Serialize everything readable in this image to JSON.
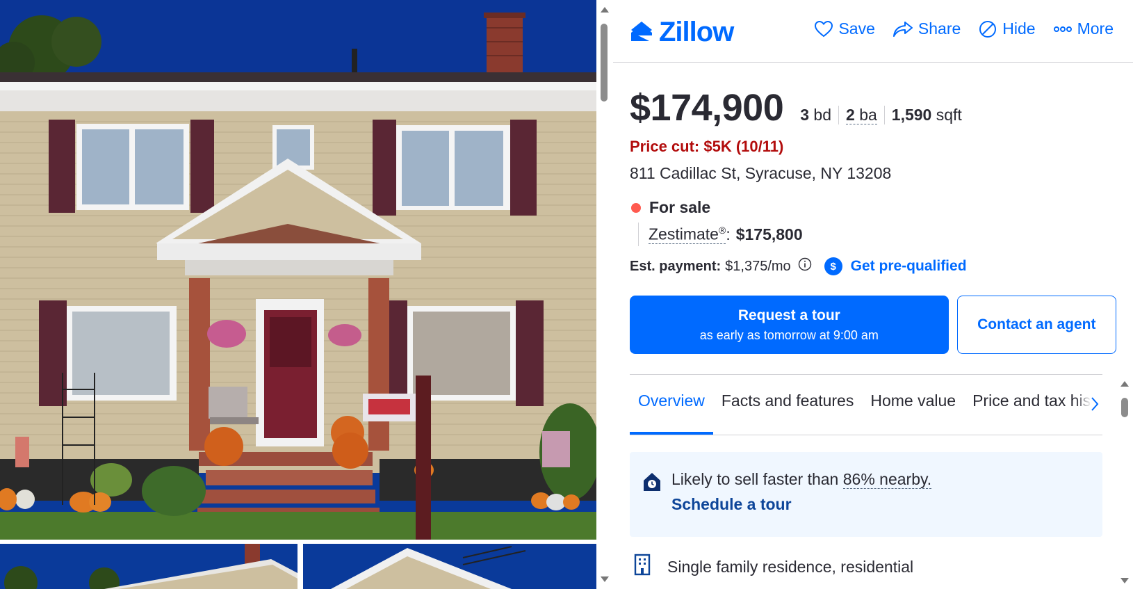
{
  "brand": {
    "name": "Zillow",
    "color": "#006aff",
    "icon": "zillow-logo-icon"
  },
  "header_actions": [
    {
      "label": "Save",
      "icon": "heart-icon"
    },
    {
      "label": "Share",
      "icon": "share-arrow-icon"
    },
    {
      "label": "Hide",
      "icon": "hide-circle-slash-icon"
    },
    {
      "label": "More",
      "icon": "more-dots-icon"
    }
  ],
  "listing": {
    "price": "$174,900",
    "beds_value": "3",
    "beds_unit": "bd",
    "baths_value": "2",
    "baths_unit": "ba",
    "sqft_value": "1,590",
    "sqft_unit": "sqft",
    "price_cut": "Price cut: $5K (10/11)",
    "address": "811 Cadillac St, Syracuse, NY 13208",
    "status": "For sale",
    "status_color": "#ff5a4f",
    "zestimate_label": "Zestimate",
    "zestimate_mark": "®",
    "zestimate_value": "$175,800",
    "payment_label": "Est. payment:",
    "payment_value": "$1,375/mo",
    "prequal_label": "Get pre-qualified",
    "prequal_icon_text": "$"
  },
  "buttons": {
    "tour_label": "Request a tour",
    "tour_sub": "as early as tomorrow at 9:00 am",
    "contact_label": "Contact an agent"
  },
  "tabs": [
    {
      "label": "Overview",
      "active": true
    },
    {
      "label": "Facts and features",
      "active": false
    },
    {
      "label": "Home value",
      "active": false
    },
    {
      "label": "Price and tax history",
      "active": false
    }
  ],
  "insight": {
    "text_before": "Likely to sell faster than",
    "pct": "86% nearby.",
    "link": "Schedule a tour",
    "icon": "house-clock-icon"
  },
  "home_type": {
    "text": "Single family residence, residential",
    "icon": "building-icon"
  }
}
